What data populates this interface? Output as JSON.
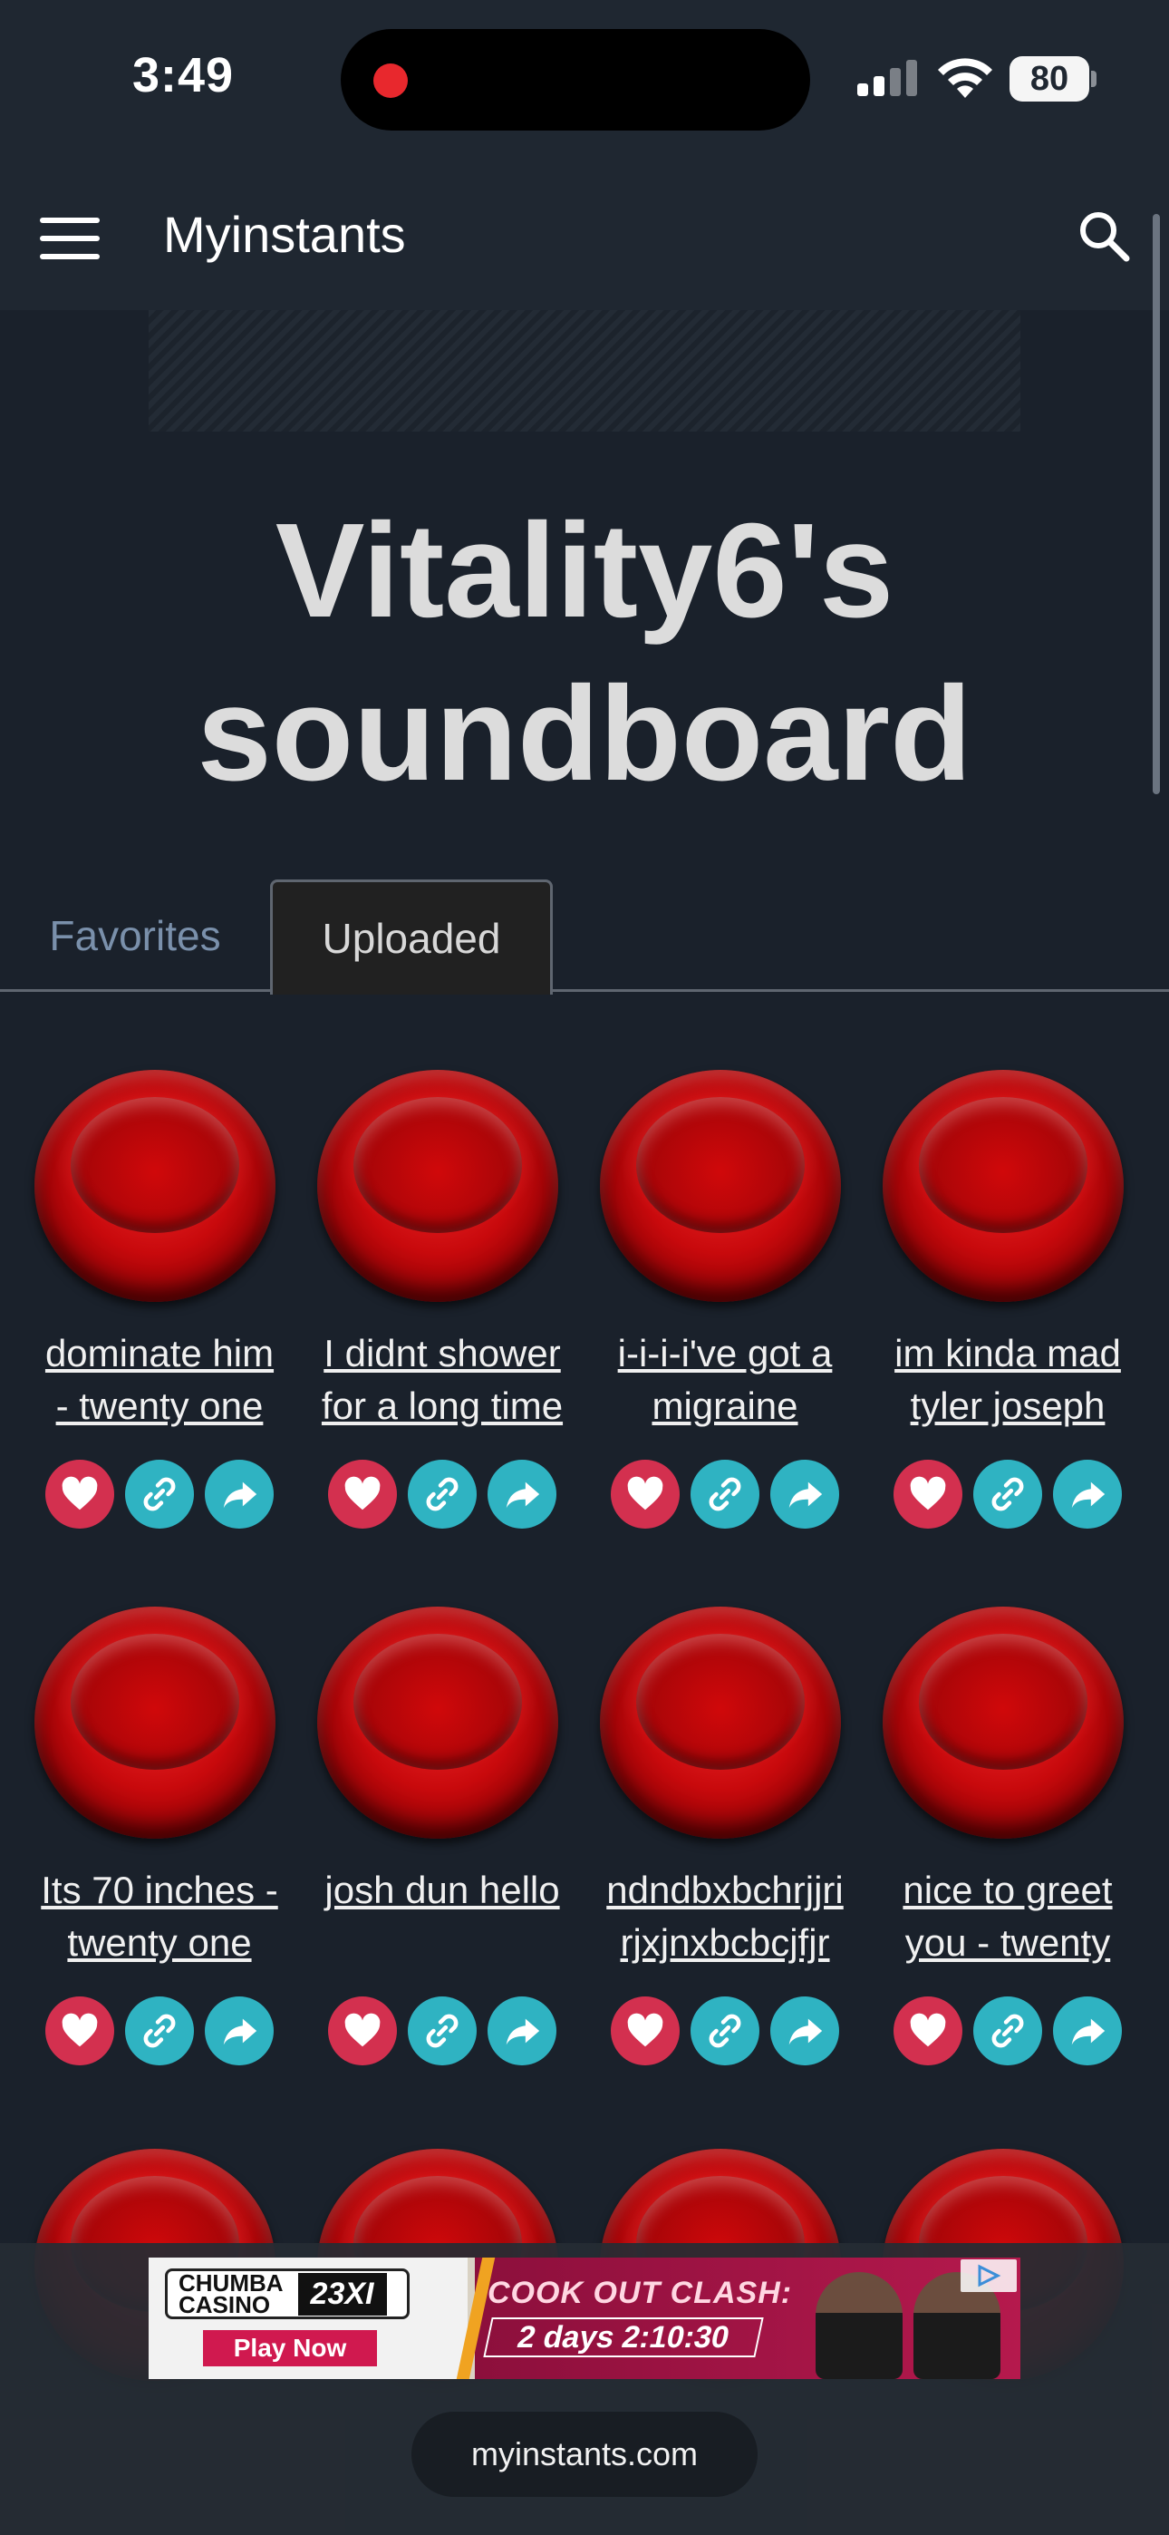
{
  "status_bar": {
    "time": "3:49",
    "battery": "80",
    "recording_color": "#e8282d"
  },
  "header": {
    "site_title": "Myinstants",
    "menu_icon": "hamburger-menu-icon",
    "search_icon": "search-icon"
  },
  "page": {
    "title_line1": "Vitality6's",
    "title_line2": "soundboard"
  },
  "tabs": [
    {
      "label": "Favorites",
      "active": false
    },
    {
      "label": "Uploaded",
      "active": true
    }
  ],
  "sounds": [
    {
      "label_line1": "dominate him",
      "label_line2": "- twenty one"
    },
    {
      "label_line1": "I didnt shower",
      "label_line2": "for a long time"
    },
    {
      "label_line1": "i-i-i-i've got a",
      "label_line2": "migraine"
    },
    {
      "label_line1": "im kinda mad",
      "label_line2": "tyler joseph"
    },
    {
      "label_line1": "Its 70 inches -",
      "label_line2": "twenty one"
    },
    {
      "label_line1": "josh dun hello",
      "label_line2": ""
    },
    {
      "label_line1": "ndndbxbchrjjri",
      "label_line2": "rjxjnxbcbcjfjr"
    },
    {
      "label_line1": "nice to greet",
      "label_line2": "you - twenty"
    }
  ],
  "actions": {
    "favorite_icon": "heart-icon",
    "copy_link_icon": "link-icon",
    "share_icon": "share-icon",
    "favorite_color": "#d3304f",
    "action_color": "#2fb3c2"
  },
  "ad": {
    "brand_line1": "CHUMBA",
    "brand_line2": "CASINO",
    "team": "23XI",
    "cta": "Play Now",
    "headline": "COOK OUT CLASH:",
    "countdown": "2 days 2:10:30"
  },
  "browser": {
    "url": "myinstants.com"
  }
}
